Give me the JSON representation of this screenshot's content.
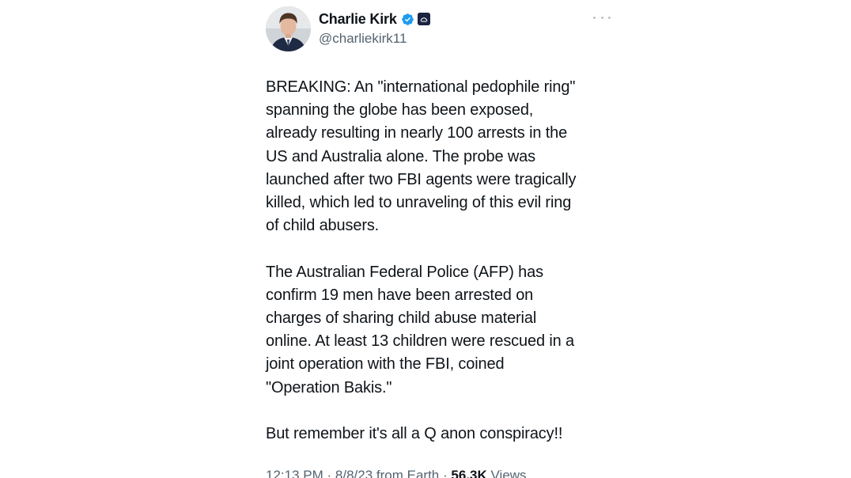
{
  "tweet": {
    "author": {
      "display_name": "Charlie Kirk",
      "handle": "@charliekirk11",
      "verified": true,
      "verified_color": "#1d9bf0",
      "avatar_icon": "profile-photo",
      "affiliate_badge_icon": "organization-badge"
    },
    "more_icon": "ellipsis-icon",
    "body": {
      "paragraph_1": "BREAKING: An \"international pedophile ring\"\nspanning the globe has been exposed,\nalready resulting in nearly 100 arrests in the\nUS and Australia alone. The probe was\nlaunched after two FBI agents were tragically\nkilled, which led to unraveling of this evil ring\nof child abusers.",
      "paragraph_2": "The Australian Federal Police (AFP) has\nconfirm 19 men have been arrested on\ncharges of sharing child abuse material\nonline. At least 13 children were rescued in a\njoint operation with the FBI, coined\n\"Operation Bakis.\"",
      "paragraph_3": "But remember it's all a Q anon conspiracy!!"
    },
    "meta": {
      "time": "12:13 PM",
      "date": "8/8/23",
      "source": "from Earth",
      "separator": "·",
      "views_count": "56.3K",
      "views_label": "Views"
    }
  }
}
